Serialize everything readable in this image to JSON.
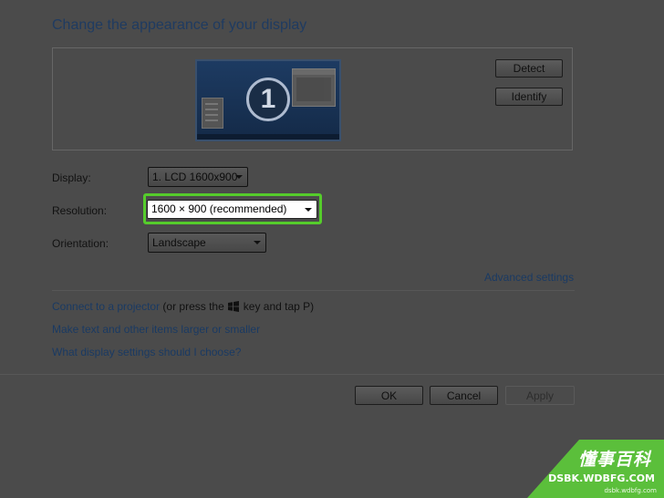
{
  "header": {
    "title": "Change the appearance of your display"
  },
  "preview": {
    "monitor_number": "1",
    "detect_label": "Detect",
    "identify_label": "Identify"
  },
  "settings": {
    "display_label": "Display:",
    "display_value": "1. LCD 1600x900",
    "resolution_label": "Resolution:",
    "resolution_value": "1600 × 900 (recommended)",
    "orientation_label": "Orientation:",
    "orientation_value": "Landscape"
  },
  "links": {
    "advanced_settings": "Advanced settings",
    "connect_projector": "Connect to a projector",
    "projector_hint_before": "(or press the",
    "projector_hint_after": "key and tap P)",
    "text_size": "Make text and other items larger or smaller",
    "display_help": "What display settings should I choose?"
  },
  "footer": {
    "ok_label": "OK",
    "cancel_label": "Cancel",
    "apply_label": "Apply"
  },
  "watermark": {
    "cn_text": "懂事百科",
    "en_text": "DSBK.WDBFG.COM",
    "small_text": "dsbk.wdbfg.com"
  },
  "colors": {
    "highlight": "#55cc2b",
    "link": "#1a3a63",
    "background": "#4b4b4b",
    "watermark": "#5bbf3b"
  },
  "icons": {
    "windows_key": "windows-logo-icon",
    "dropdown": "chevron-down-icon"
  }
}
